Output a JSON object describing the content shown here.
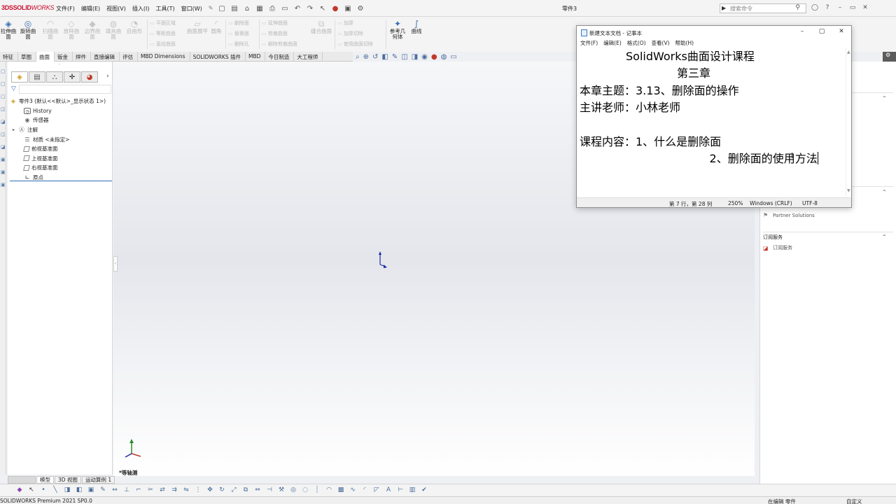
{
  "app": {
    "logo_ds": "3DS",
    "logo_solid": "SOLID",
    "logo_works": "WORKS",
    "doc_title": "零件3",
    "menu": [
      "文件(F)",
      "编辑(E)",
      "视图(V)",
      "插入(I)",
      "工具(T)",
      "窗口(W)"
    ],
    "search_placeholder": "搜索命令"
  },
  "command_manager": {
    "enabled": [
      {
        "label": "拉伸曲面"
      },
      {
        "label": "旋转曲面"
      },
      {
        "label": "参考几何体"
      },
      {
        "label": "曲线"
      }
    ],
    "disabled": [
      {
        "label": "扫描曲面"
      },
      {
        "label": "放样曲面"
      },
      {
        "label": "边界曲面"
      },
      {
        "label": "填充曲面"
      },
      {
        "label": "自由形"
      },
      {
        "label": "曲面展平"
      },
      {
        "label": "圆角"
      },
      {
        "label": "缝合曲面"
      }
    ],
    "small_disabled": [
      "平面区域",
      "等距曲面",
      "直纹曲面",
      "删除面",
      "替换面",
      "删除孔",
      "延伸曲面",
      "剪裁曲面",
      "解除剪裁曲面",
      "加厚",
      "加厚切除",
      "使用曲面切除"
    ]
  },
  "tabs": [
    "特征",
    "草图",
    "曲面",
    "钣金",
    "焊件",
    "直接编辑",
    "评估",
    "MBD Dimensions",
    "SOLIDWORKS 插件",
    "MBD",
    "今日制造",
    "大工程师"
  ],
  "active_tab": "曲面",
  "feature_tree": {
    "root": "零件3  (默认<<默认>_显示状态 1>)",
    "items": [
      {
        "label": "History",
        "icon": "history-icon"
      },
      {
        "label": "传感器",
        "icon": "sensor-icon"
      },
      {
        "label": "注解",
        "icon": "annotation-icon"
      },
      {
        "label": "材质 <未指定>",
        "icon": "material-icon"
      },
      {
        "label": "前视基准面",
        "icon": "plane-icon"
      },
      {
        "label": "上视基准面",
        "icon": "plane-icon"
      },
      {
        "label": "右视基准面",
        "icon": "plane-icon"
      },
      {
        "label": "原点",
        "icon": "origin-icon"
      }
    ]
  },
  "graphics": {
    "view_label": "*等轴测"
  },
  "model_tabs": [
    "模型",
    "3D 视图",
    "运动算例 1"
  ],
  "status_bar": {
    "left": "SOLIDWORKS Premium 2021 SP0.0",
    "mid": "在编辑 零件",
    "right": "自定义"
  },
  "task_pane": {
    "partner": "Partner Solutions",
    "subscription_head": "订阅服务",
    "subscription_item": "订阅服务"
  },
  "notepad": {
    "title": "新建文本文档 - 记事本",
    "menu": [
      "文件(F)",
      "编辑(E)",
      "格式(O)",
      "查看(V)",
      "帮助(H)"
    ],
    "lines": [
      "SolidWorks曲面设计课程",
      "第三章",
      "本章主题：3.13、删除面的操作",
      "主讲老师：小林老师",
      "",
      "课程内容：1、什么是删除面",
      "                  2、删除面的使用方法"
    ],
    "status": {
      "position": "第 7 行，第 28 列",
      "zoom": "250%",
      "eol": "Windows (CRLF)",
      "encoding": "UTF-8"
    }
  },
  "colors": {
    "brand": "#c8102e",
    "accent": "#2e6bb5",
    "tree_root_icon": "#c79b1b"
  }
}
